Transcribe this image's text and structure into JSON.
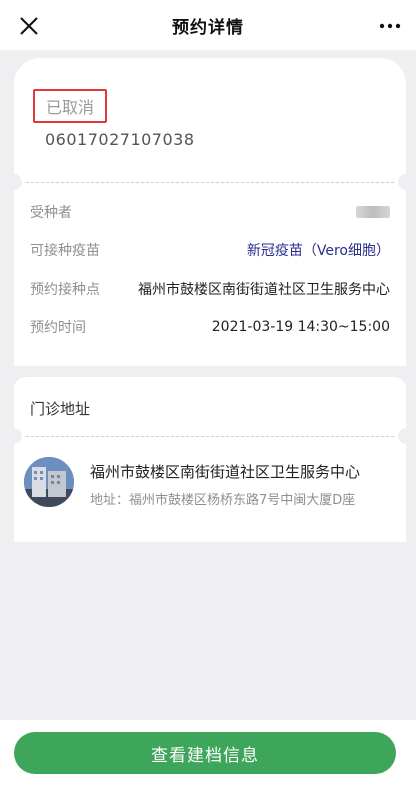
{
  "header": {
    "title": "预约详情",
    "close_icon": "close-icon",
    "more_icon": "more-icon"
  },
  "appointment": {
    "status": "已取消",
    "order_no": "06017027107038",
    "rows": [
      {
        "label": "受种者",
        "value": ""
      },
      {
        "label": "可接种疫苗",
        "value": "新冠疫苗（Vero细胞）"
      },
      {
        "label": "预约接种点",
        "value": "福州市鼓楼区南街街道社区卫生服务中心"
      },
      {
        "label": "预约时间",
        "value": "2021-03-19 14:30~15:00"
      }
    ]
  },
  "clinic": {
    "section_title": "门诊地址",
    "name": "福州市鼓楼区南街街道社区卫生服务中心",
    "address": "地址：福州市鼓楼区杨桥东路7号中闽大厦D座"
  },
  "footer": {
    "button_label": "查看建档信息"
  },
  "colors": {
    "accent_green": "#3ea65a",
    "link_blue": "#2a2e8c",
    "status_border": "#e0383b",
    "background": "#efeff1"
  }
}
